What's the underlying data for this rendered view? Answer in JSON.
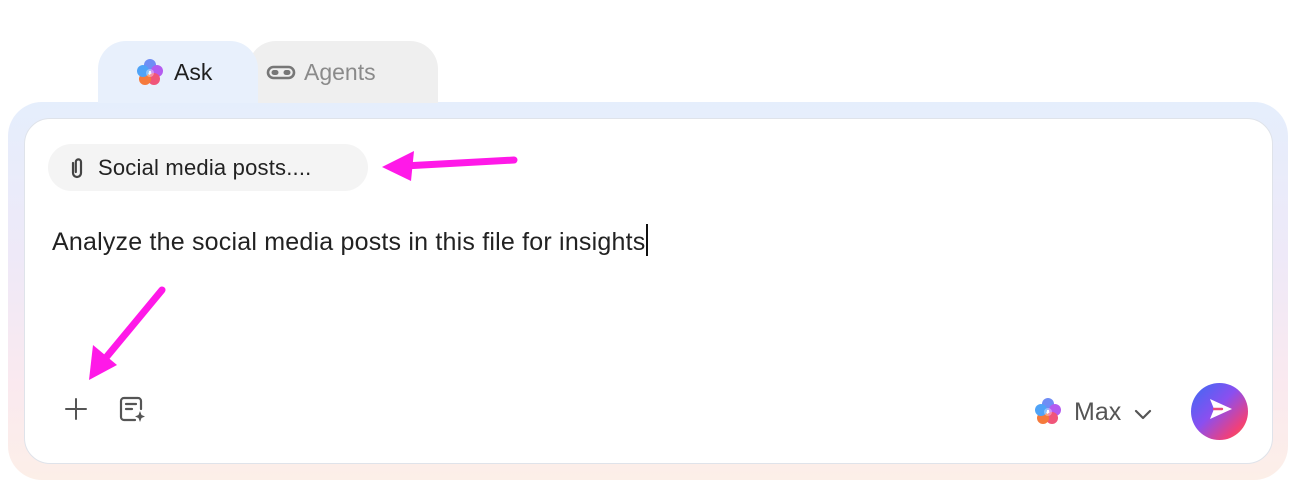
{
  "tabs": [
    {
      "label": "Ask",
      "icon": "sparkle-flower-icon",
      "active": true
    },
    {
      "label": "Agents",
      "icon": "goggles-icon",
      "active": false
    }
  ],
  "attachment": {
    "label": "Social media posts....",
    "icon": "paperclip-icon"
  },
  "prompt": {
    "value": "Analyze the social media posts in this file for insights"
  },
  "toolbar": {
    "add_icon": "plus-icon",
    "notes_icon": "notes-sparkle-icon",
    "model_label": "Max",
    "model_icon": "sparkle-flower-icon",
    "send_icon": "send-icon"
  },
  "annotations": {
    "color": "#ff19e8",
    "arrows": [
      "arrow-pointing-to-attachment",
      "arrow-pointing-to-add-button"
    ]
  },
  "colors": {
    "frame_gradient_top": "#e5eefc",
    "frame_gradient_bottom": "#fcefe8",
    "send_gradient_start": "#3a6cf4",
    "send_gradient_end": "#f56a3c"
  }
}
